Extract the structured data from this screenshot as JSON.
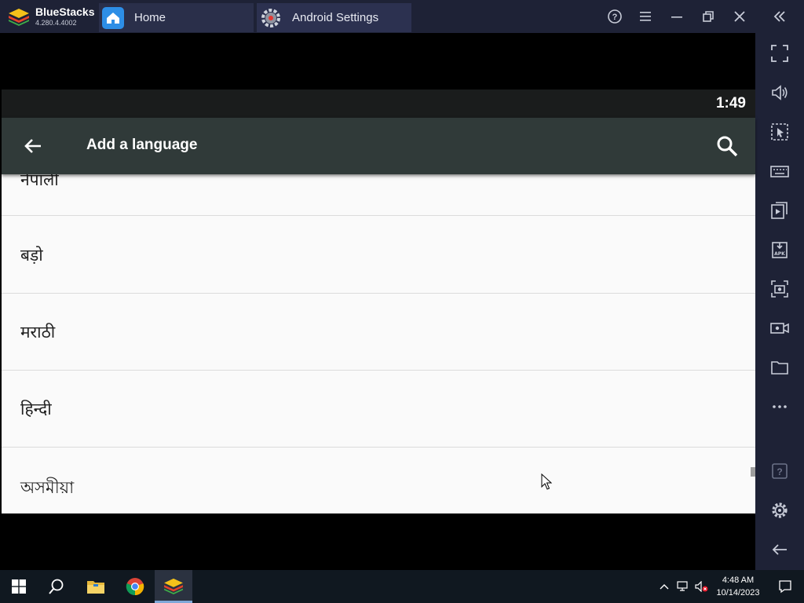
{
  "bluestacks": {
    "brand_name": "BlueStacks",
    "version": "4.280.4.4002",
    "tabs": [
      {
        "label": "Home",
        "icon": "home-icon"
      },
      {
        "label": "Android Settings",
        "icon": "gear-icon"
      }
    ],
    "window_controls": [
      "help-icon",
      "menu-icon",
      "minimize-icon",
      "restore-icon",
      "close-icon",
      "collapse-sidebar-icon"
    ]
  },
  "android": {
    "status_time": "1:49",
    "appbar": {
      "title": "Add a language",
      "back_icon": "arrow-back-icon",
      "search_icon": "search-icon"
    },
    "languages": [
      "नेपाली",
      "बड़ो",
      "मराठी",
      "हिन्दी",
      "অসমীয়া"
    ]
  },
  "sidebar": {
    "buttons": [
      "fullscreen-icon",
      "volume-icon",
      "pointer-select-icon",
      "keyboard-icon",
      "media-manager-icon",
      "apk-install-icon",
      "screenshot-icon",
      "video-record-icon",
      "folder-icon",
      "more-icon",
      "help-icon",
      "settings-icon",
      "back-icon"
    ]
  },
  "taskbar": {
    "time": "4:48 AM",
    "date": "10/14/2023",
    "items": [
      "windows-start-icon",
      "search-icon",
      "file-explorer-icon",
      "chrome-icon",
      "bluestacks-icon"
    ]
  },
  "colors": {
    "titlebar": "#1e2236",
    "appbar": "#303a39",
    "list_bg": "#fafafa",
    "taskbar": "#101820"
  }
}
